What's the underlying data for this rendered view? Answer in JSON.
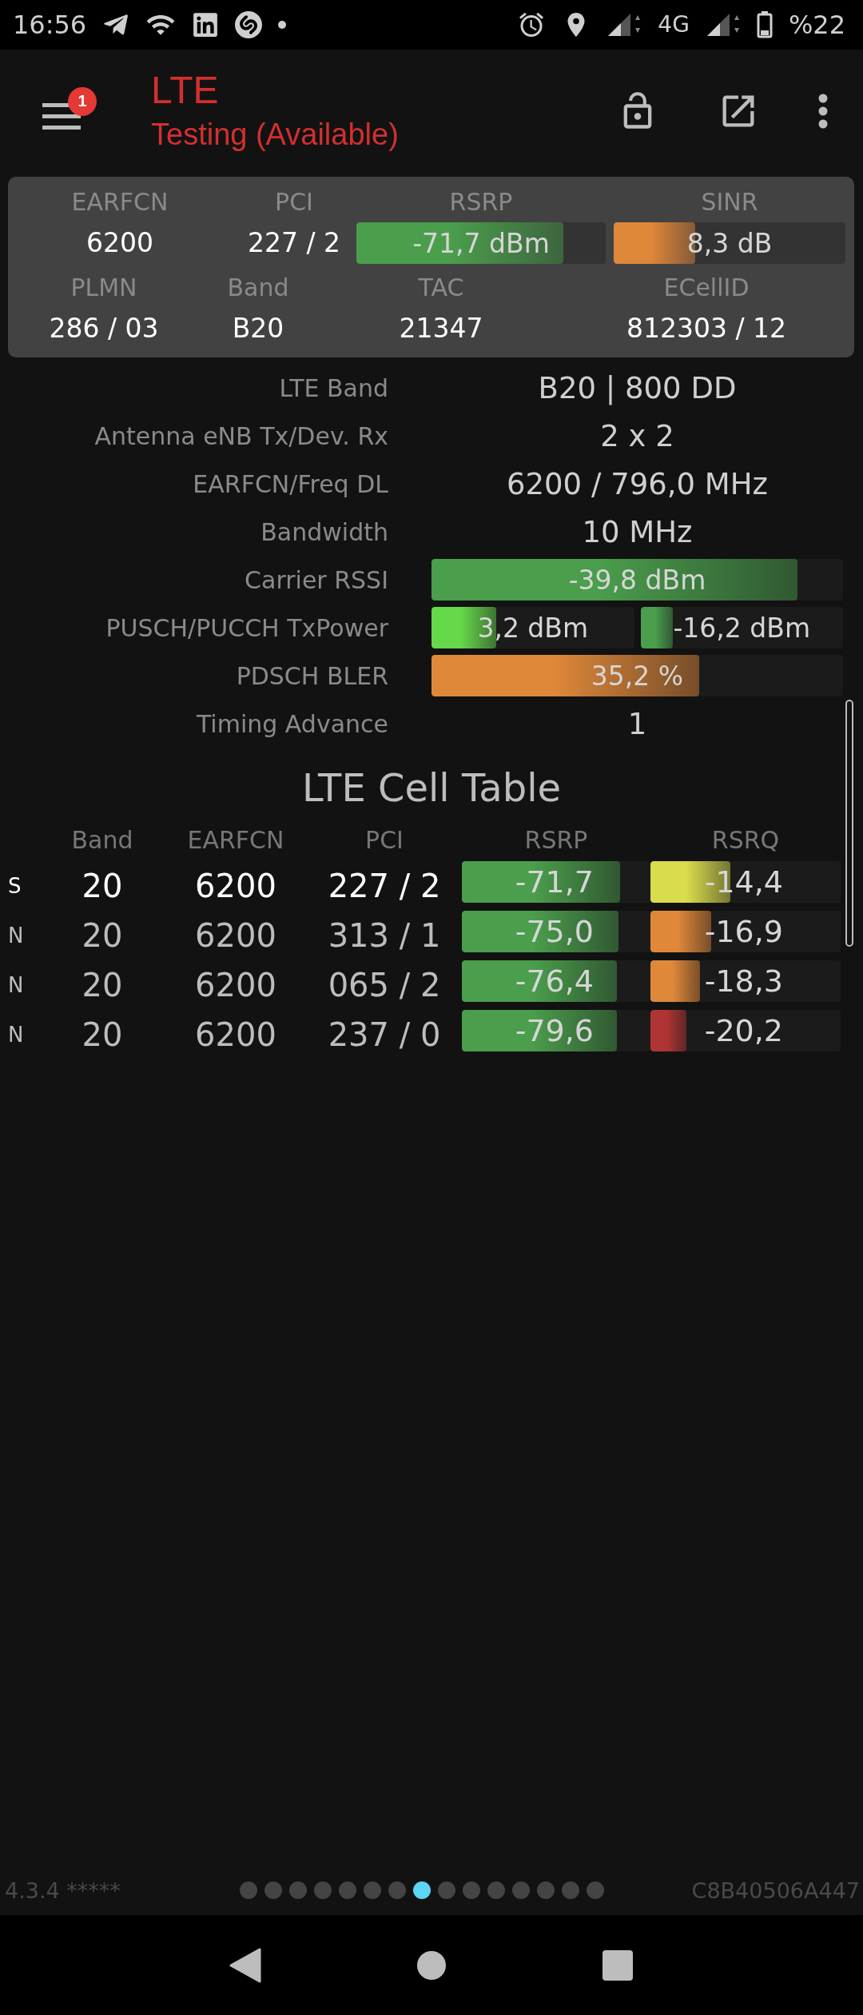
{
  "status_bar": {
    "time": "16:56",
    "network": "4G",
    "battery": "%22"
  },
  "app_bar": {
    "title": "LTE",
    "subtitle": "Testing (Available)",
    "menu_badge": "1"
  },
  "summary": {
    "top": [
      {
        "kind": "text",
        "label": "EARFCN",
        "value": "6200"
      },
      {
        "kind": "text",
        "label": "PCI",
        "value": "227 / 2"
      },
      {
        "kind": "bar",
        "label": "RSRP",
        "value": "-71,7 dBm",
        "level": 0.83,
        "color": "#4a9e4c"
      },
      {
        "kind": "bar",
        "label": "SINR",
        "value": "8,3 dB",
        "level": 0.35,
        "color": "#e0883a"
      }
    ],
    "bottom": [
      {
        "kind": "text",
        "label": "PLMN",
        "value": "286 / 03"
      },
      {
        "kind": "text",
        "label": "Band",
        "value": "B20"
      },
      {
        "kind": "text",
        "label": "TAC",
        "value": "21347"
      },
      {
        "kind": "text",
        "label": "ECellID",
        "value": "812303 / 12"
      }
    ]
  },
  "details": [
    {
      "kind": "text",
      "label": "LTE Band",
      "value": "B20 | 800 DD"
    },
    {
      "kind": "text",
      "label": "Antenna eNB Tx/Dev. Rx",
      "value": "2 x 2"
    },
    {
      "kind": "text",
      "label": "EARFCN/Freq DL",
      "value": "6200 / 796,0 MHz"
    },
    {
      "kind": "text",
      "label": "Bandwidth",
      "value": "10 MHz"
    },
    {
      "kind": "bar",
      "label": "Carrier RSSI",
      "bars": [
        {
          "value": "-39,8 dBm",
          "level": 0.89,
          "color": "#4a9e4c"
        }
      ]
    },
    {
      "kind": "bar",
      "label": "PUSCH/PUCCH TxPower",
      "bars": [
        {
          "value": "3,2 dBm",
          "level": 0.32,
          "color": "#66d94a"
        },
        {
          "value": "-16,2 dBm",
          "level": 0.16,
          "color": "#4a9e4c"
        }
      ]
    },
    {
      "kind": "bar",
      "label": "PDSCH BLER",
      "bars": [
        {
          "value": "35,2 %",
          "level": 0.65,
          "color": "#e0883a"
        }
      ]
    },
    {
      "kind": "text",
      "label": "Timing Advance",
      "value": "1"
    }
  ],
  "cell_table": {
    "title": "LTE Cell Table",
    "columns": [
      "Band",
      "EARFCN",
      "PCI",
      "RSRP",
      "RSRQ"
    ],
    "rows": [
      {
        "type": "S",
        "serving": true,
        "band": "20",
        "earfcn": "6200",
        "pci": "227 / 2",
        "rsrp": {
          "value": "-71,7",
          "level": 0.84
        },
        "rsrq": {
          "value": "-14,4",
          "level": 0.42,
          "color": "#d9dc4c"
        }
      },
      {
        "type": "N",
        "serving": false,
        "band": "20",
        "earfcn": "6200",
        "pci": "313 / 1",
        "rsrp": {
          "value": "-75,0",
          "level": 0.83
        },
        "rsrq": {
          "value": "-16,9",
          "level": 0.32,
          "color": "#e0883a"
        }
      },
      {
        "type": "N",
        "serving": false,
        "band": "20",
        "earfcn": "6200",
        "pci": "065 / 2",
        "rsrp": {
          "value": "-76,4",
          "level": 0.82
        },
        "rsrq": {
          "value": "-18,3",
          "level": 0.26,
          "color": "#e0883a"
        }
      },
      {
        "type": "N",
        "serving": false,
        "band": "20",
        "earfcn": "6200",
        "pci": "237 / 0",
        "rsrp": {
          "value": "-79,6",
          "level": 0.82
        },
        "rsrq": {
          "value": "-20,2",
          "level": 0.19,
          "color": "#b03434"
        }
      }
    ]
  },
  "footer": {
    "version": "4.3.4 *****",
    "device_id": "C8B40506A447",
    "pages": [
      {
        "selected": false
      },
      {
        "selected": false
      },
      {
        "selected": false
      },
      {
        "selected": false
      },
      {
        "selected": false
      },
      {
        "selected": false
      },
      {
        "selected": false
      },
      {
        "selected": true
      },
      {
        "selected": false
      },
      {
        "selected": false
      },
      {
        "selected": false
      },
      {
        "selected": false
      },
      {
        "selected": false
      },
      {
        "selected": false
      },
      {
        "selected": false
      }
    ]
  }
}
